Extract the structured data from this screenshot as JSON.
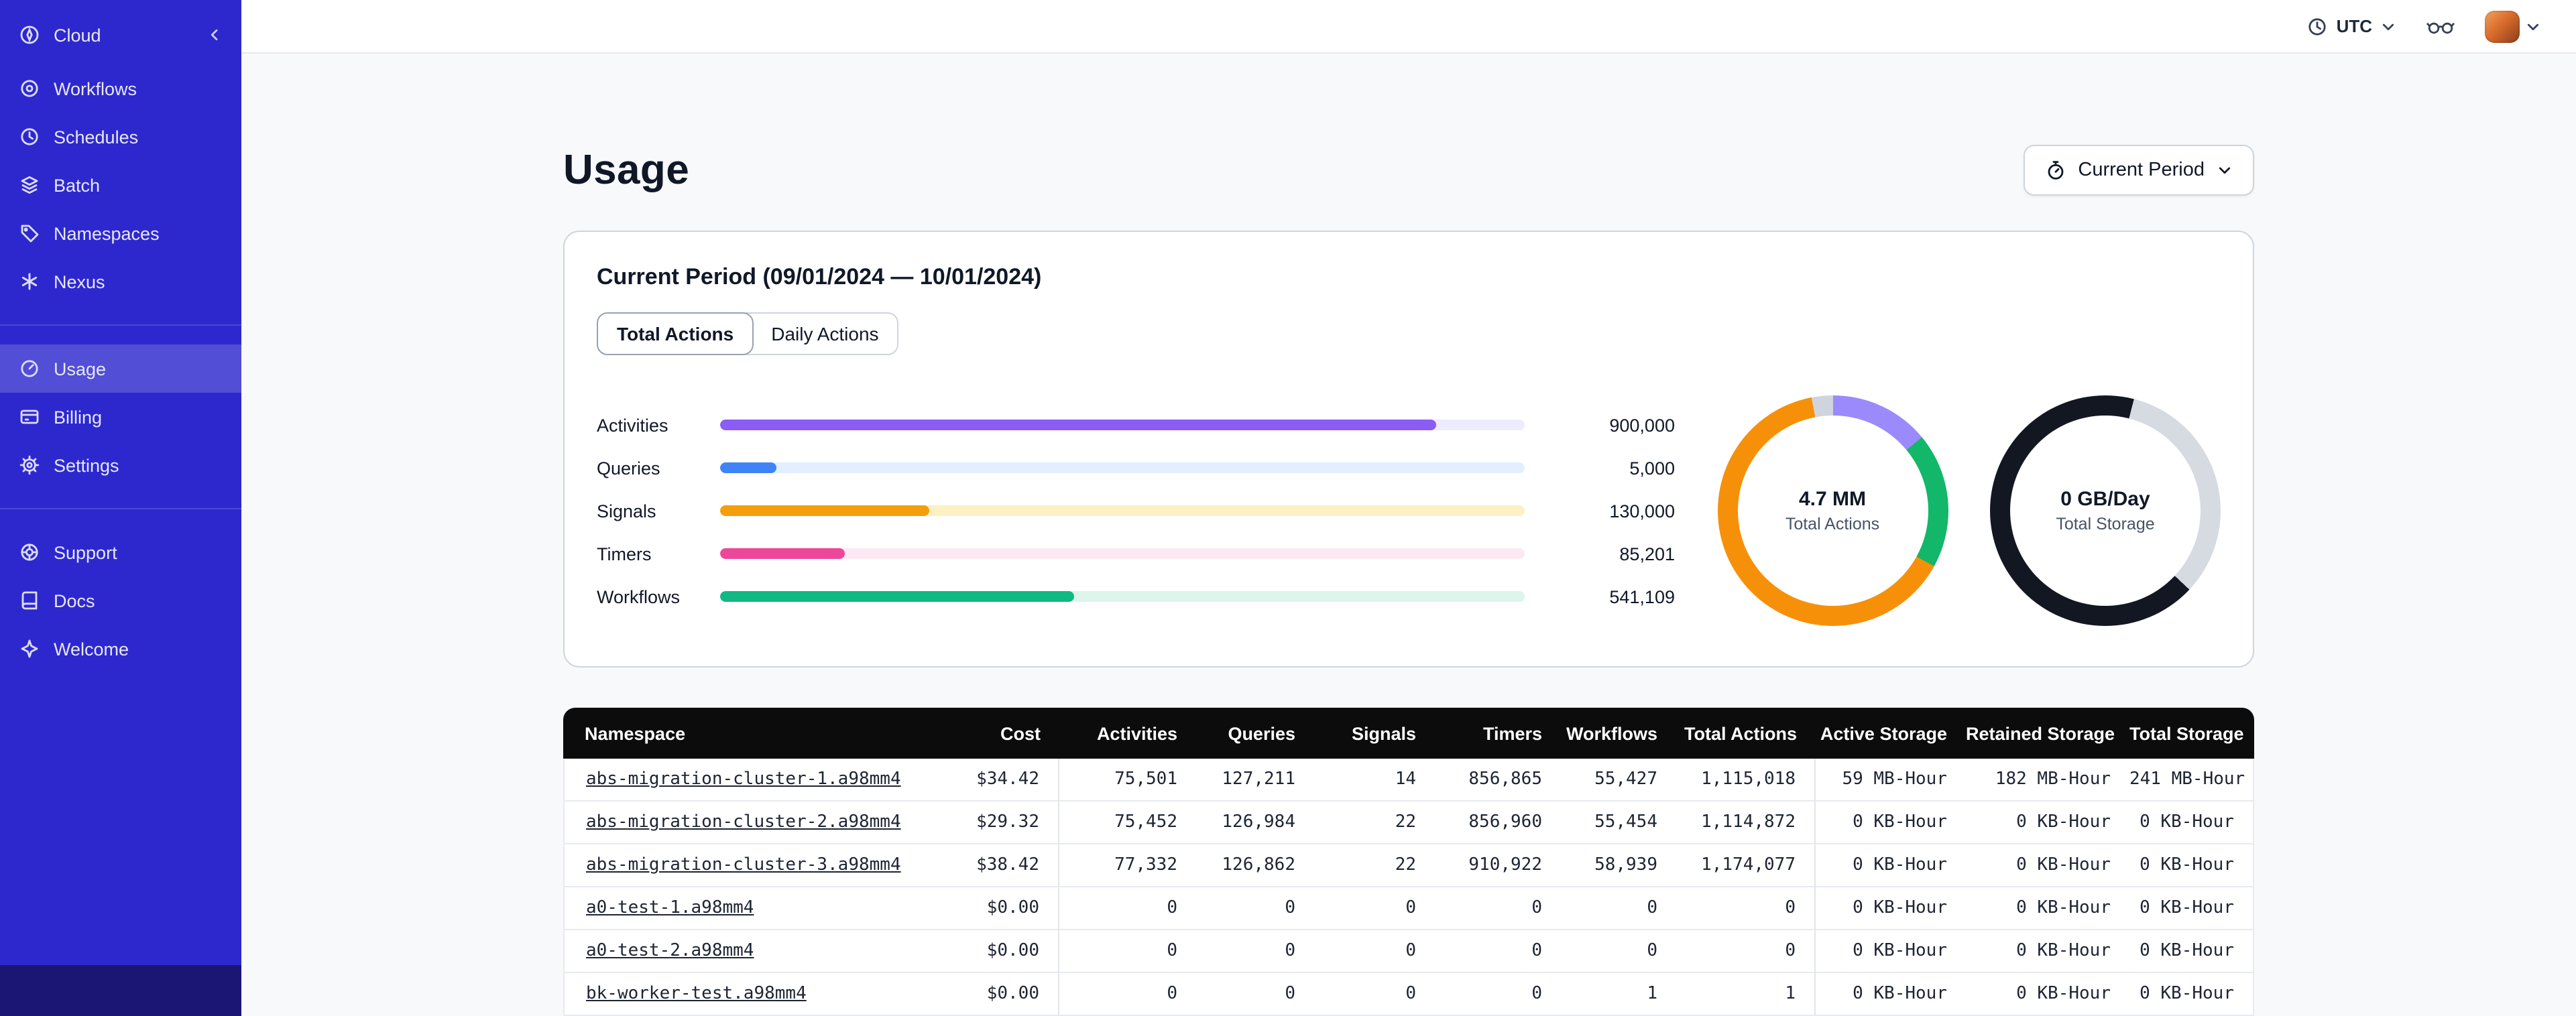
{
  "topbar": {
    "timezone_label": "UTC"
  },
  "sidebar": {
    "header": {
      "label": "Cloud"
    },
    "groups": [
      {
        "items": [
          {
            "label": "Workflows",
            "icon": "workflows-icon"
          },
          {
            "label": "Schedules",
            "icon": "clock-icon"
          },
          {
            "label": "Batch",
            "icon": "layers-icon"
          },
          {
            "label": "Namespaces",
            "icon": "tag-icon"
          },
          {
            "label": "Nexus",
            "icon": "asterisk-icon"
          }
        ]
      },
      {
        "items": [
          {
            "label": "Usage",
            "icon": "gauge-icon",
            "active": true
          },
          {
            "label": "Billing",
            "icon": "credit-card-icon"
          },
          {
            "label": "Settings",
            "icon": "gear-icon"
          }
        ]
      },
      {
        "items": [
          {
            "label": "Support",
            "icon": "lifebuoy-icon"
          },
          {
            "label": "Docs",
            "icon": "book-icon"
          },
          {
            "label": "Welcome",
            "icon": "sparkle-icon"
          }
        ]
      }
    ]
  },
  "page": {
    "title": "Usage",
    "period_selector_label": "Current Period"
  },
  "usage_card": {
    "title": "Current Period (09/01/2024 — 10/01/2024)",
    "tabs": {
      "total": "Total Actions",
      "daily": "Daily Actions"
    },
    "active_tab": "Total Actions"
  },
  "chart_data": [
    {
      "type": "bar",
      "orientation": "horizontal",
      "categories": [
        "Activities",
        "Queries",
        "Signals",
        "Timers",
        "Workflows"
      ],
      "values": [
        900000,
        5000,
        130000,
        85201,
        541109
      ],
      "value_labels": [
        "900,000",
        "5,000",
        "130,000",
        "85,201",
        "541,109"
      ],
      "fill_pct": [
        89,
        7,
        26,
        15.5,
        44
      ],
      "colors": [
        "#8B5CF6",
        "#3F83F8",
        "#F59E0B",
        "#EC4899",
        "#10B981"
      ],
      "track_colors": [
        "#EDEBFE",
        "#E1EFFE",
        "#FDF0C3",
        "#FCE8F3",
        "#DDF5EA"
      ],
      "title": "",
      "xlabel": "",
      "ylabel": ""
    },
    {
      "type": "donut",
      "center_value": "4.7 MM",
      "center_label": "Total Actions",
      "segments": [
        {
          "name": "activities",
          "color": "#9B8AFB",
          "from": 0,
          "to": 14
        },
        {
          "name": "workflows",
          "color": "#12B76A",
          "from": 14,
          "to": 33
        },
        {
          "name": "signals-timers",
          "color": "#F79009",
          "from": 33,
          "to": 97
        },
        {
          "name": "other",
          "color": "#D0D5DD",
          "from": 97,
          "to": 100
        }
      ]
    },
    {
      "type": "donut",
      "center_value": "0 GB/Day",
      "center_label": "Total Storage",
      "segments": [
        {
          "name": "dark-a",
          "color": "#131722",
          "from": 0,
          "to": 4
        },
        {
          "name": "light",
          "color": "#D6DAE1",
          "from": 4,
          "to": 37
        },
        {
          "name": "dark-b",
          "color": "#131722",
          "from": 37,
          "to": 100
        }
      ]
    }
  ],
  "table": {
    "columns": [
      "Namespace",
      "Cost",
      "Activities",
      "Queries",
      "Signals",
      "Timers",
      "Workflows",
      "Total Actions",
      "Active Storage",
      "Retained Storage",
      "Total Storage"
    ],
    "rows": [
      {
        "namespace": "abs-migration-cluster-1.a98mm4",
        "cost": "$34.42",
        "activities": "75,501",
        "queries": "127,211",
        "signals": "14",
        "timers": "856,865",
        "workflows": "55,427",
        "total_actions": "1,115,018",
        "active_storage": "59 MB-Hour",
        "retained_storage": "182 MB-Hour",
        "total_storage": "241 MB-Hour"
      },
      {
        "namespace": "abs-migration-cluster-2.a98mm4",
        "cost": "$29.32",
        "activities": "75,452",
        "queries": "126,984",
        "signals": "22",
        "timers": "856,960",
        "workflows": "55,454",
        "total_actions": "1,114,872",
        "active_storage": "0 KB-Hour",
        "retained_storage": "0 KB-Hour",
        "total_storage": "0 KB-Hour"
      },
      {
        "namespace": "abs-migration-cluster-3.a98mm4",
        "cost": "$38.42",
        "activities": "77,332",
        "queries": "126,862",
        "signals": "22",
        "timers": "910,922",
        "workflows": "58,939",
        "total_actions": "1,174,077",
        "active_storage": "0 KB-Hour",
        "retained_storage": "0 KB-Hour",
        "total_storage": "0 KB-Hour"
      },
      {
        "namespace": "a0-test-1.a98mm4",
        "cost": "$0.00",
        "activities": "0",
        "queries": "0",
        "signals": "0",
        "timers": "0",
        "workflows": "0",
        "total_actions": "0",
        "active_storage": "0 KB-Hour",
        "retained_storage": "0 KB-Hour",
        "total_storage": "0 KB-Hour"
      },
      {
        "namespace": "a0-test-2.a98mm4",
        "cost": "$0.00",
        "activities": "0",
        "queries": "0",
        "signals": "0",
        "timers": "0",
        "workflows": "0",
        "total_actions": "0",
        "active_storage": "0 KB-Hour",
        "retained_storage": "0 KB-Hour",
        "total_storage": "0 KB-Hour"
      },
      {
        "namespace": "bk-worker-test.a98mm4",
        "cost": "$0.00",
        "activities": "0",
        "queries": "0",
        "signals": "0",
        "timers": "0",
        "workflows": "1",
        "total_actions": "1",
        "active_storage": "0 KB-Hour",
        "retained_storage": "0 KB-Hour",
        "total_storage": "0 KB-Hour"
      }
    ]
  }
}
